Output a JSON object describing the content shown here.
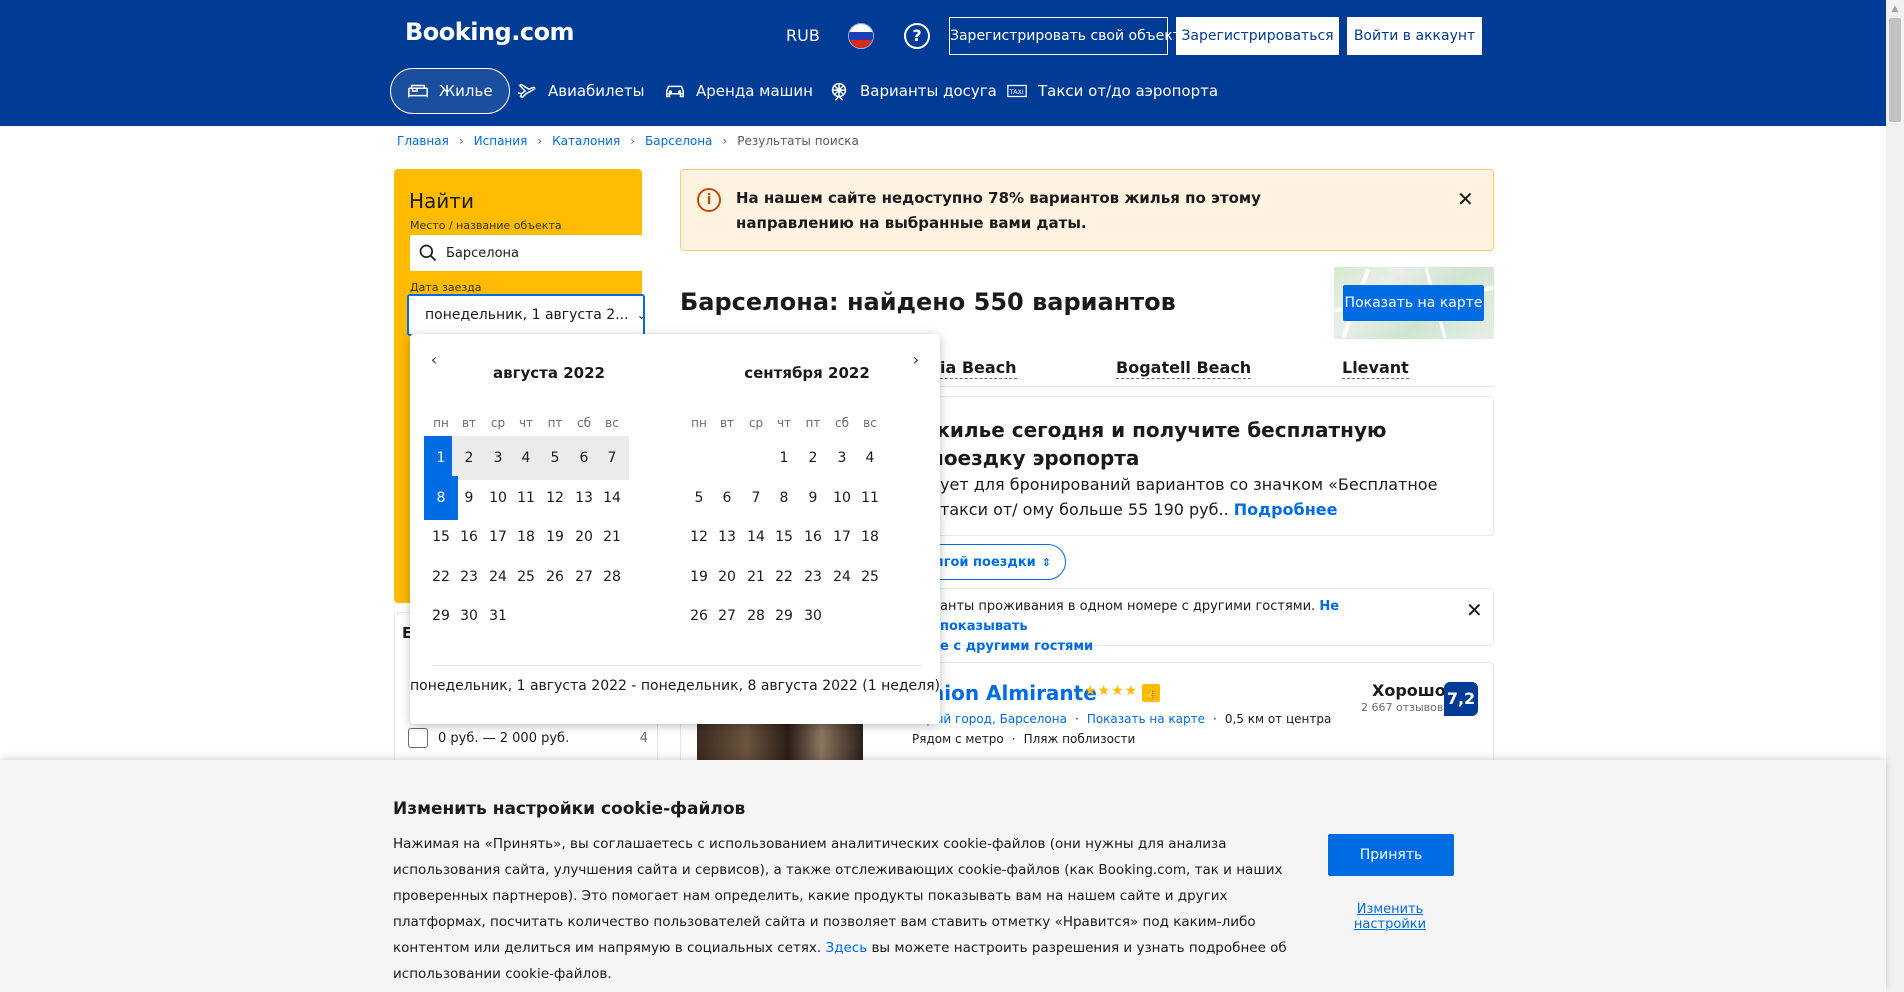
{
  "header": {
    "logo": "Booking.com",
    "currency": "RUB",
    "list_property": "Зарегистрировать свой объект",
    "register": "Зарегистрироваться",
    "sign_in": "Войти в аккаунт",
    "help_glyph": "?",
    "nav": [
      {
        "label": "Жилье",
        "icon": "bed-icon",
        "active": true
      },
      {
        "label": "Авиабилеты",
        "icon": "plane-icon",
        "active": false
      },
      {
        "label": "Аренда машин",
        "icon": "car-icon",
        "active": false
      },
      {
        "label": "Варианты досуга",
        "icon": "attractions-icon",
        "active": false
      },
      {
        "label": "Такси от/до аэропорта",
        "icon": "taxi-icon",
        "active": false
      }
    ]
  },
  "breadcrumb": [
    "Главная",
    "Испания",
    "Каталония",
    "Барселона",
    "Результаты поиска"
  ],
  "search": {
    "title": "Найти",
    "place_label": "Место / название объекта",
    "place_value": "Барселона",
    "date_label": "Дата заезда",
    "date_value": "понедельник, 1 августа 2..."
  },
  "calendar": {
    "months": [
      {
        "title": "августа 2022",
        "offset": 0,
        "days": 31
      },
      {
        "title": "сентября 2022",
        "offset": 3,
        "days": 30
      }
    ],
    "weekdays": [
      "пн",
      "вт",
      "ср",
      "чт",
      "пт",
      "сб",
      "вс"
    ],
    "selected_start": 1,
    "selected_end": 8,
    "summary": "понедельник, 1 августа 2022 - понедельник, 8 августа 2022 (1 неделя)"
  },
  "filters": {
    "heading_fragment": "Е",
    "price_option": "0 руб. — 2 000 руб.",
    "price_count": "4"
  },
  "alert": {
    "text": "На нашем сайте недоступно 78% вариантов жилья по этому направлению на выбранные вами даты.",
    "icon_glyph": "i"
  },
  "results": {
    "title": "Барселона: найдено 550 вариантов",
    "map_button": "Показать на карте",
    "beaches": [
      "ia Beach",
      "Bogatell Beach",
      "Llevant"
    ]
  },
  "promo": {
    "title": "жилье сегодня и получите бесплатную поездку эропорта",
    "text": "ует для бронирований вариантов со значком «Бесплатное такси от/ ому больше 55 190 руб..",
    "link": "Подробнее"
  },
  "sort": {
    "label": "олгой поездки"
  },
  "shared": {
    "text": "анты проживания в одном номере с другими гостями.",
    "link": "Не показывать",
    "text2": "е с другими гостями"
  },
  "hotel": {
    "name": "nion Almirante",
    "stars": "★★★★",
    "location_area": "тарый город, Барселона",
    "map_link": "Показать на карте",
    "distance": "0,5 км от центра",
    "tags": [
      "Рядом с метро",
      "Пляж поблизости"
    ],
    "review_word": "Хорошо",
    "review_count": "2 667 отзывов",
    "score": "7,2"
  },
  "cookie": {
    "title": "Изменить настройки cookie-файлов",
    "text_before_link": "Нажимая на «Принять», вы соглашаетесь с использованием аналитических cookie-файлов (они нужны для анализа использования сайта, улучшения сайта и сервисов), а также отслеживающих cookie-файлов (как Booking.com, так и наших проверенных партнеров). Это помогает нам определить, какие продукты показывать вам на нашем сайте и других платформах, посчитать количество пользователей сайта и позволяет вам ставить отметку «Нравится» под каким-либо контентом или делиться им напрямую в социальных сетях. ",
    "link": "Здесь",
    "text_after_link": " вы можете настроить разрешения и узнать подробнее об использовании cookie-файлов.",
    "accept": "Принять",
    "settings": "Изменить настройки"
  },
  "colors": {
    "brand": "#003b95",
    "accent": "#006ce4",
    "search_panel": "#febb02"
  }
}
